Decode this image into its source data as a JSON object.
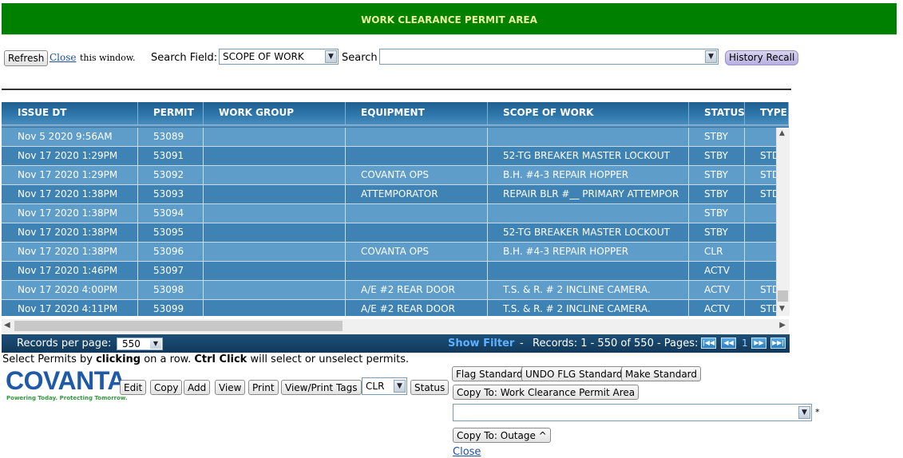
{
  "banner": {
    "title": "WORK CLEARANCE PERMIT AREA"
  },
  "topbar": {
    "refresh_label": "Refresh",
    "close_link": "Close",
    "close_suffix": "this window.",
    "search_field_label": "Search Field:",
    "search_field_value": "SCOPE OF WORK",
    "search_label": "Search",
    "search_value": "",
    "history_recall_label": "History Recall"
  },
  "grid": {
    "columns": [
      "ISSUE DT",
      "PERMIT",
      "WORK GROUP",
      "EQUIPMENT REQUESTED",
      "SCOPE OF WORK",
      "STATUS",
      "TYPE"
    ],
    "rows": [
      [
        "Nov 5 2020 9:56AM",
        "53089",
        "",
        "",
        "",
        "STBY",
        ""
      ],
      [
        "Nov 17 2020 1:29PM",
        "53091",
        "",
        "",
        "52-TG BREAKER MASTER LOCKOUT",
        "STBY",
        "STD"
      ],
      [
        "Nov 17 2020 1:29PM",
        "53092",
        "",
        "COVANTA OPS",
        "B.H. #4-3 REPAIR HOPPER",
        "STBY",
        "STD"
      ],
      [
        "Nov 17 2020 1:38PM",
        "53093",
        "",
        "ATTEMPORATOR",
        "REPAIR BLR #__ PRIMARY ATTEMPOR",
        "STBY",
        "STD"
      ],
      [
        "Nov 17 2020 1:38PM",
        "53094",
        "",
        "",
        "",
        "STBY",
        ""
      ],
      [
        "Nov 17 2020 1:38PM",
        "53095",
        "",
        "",
        "52-TG BREAKER MASTER LOCKOUT",
        "STBY",
        ""
      ],
      [
        "Nov 17 2020 1:38PM",
        "53096",
        "",
        "COVANTA OPS",
        "B.H. #4-3 REPAIR HOPPER",
        "CLR",
        ""
      ],
      [
        "Nov 17 2020 1:46PM",
        "53097",
        "",
        "",
        "",
        "ACTV",
        ""
      ],
      [
        "Nov 17 2020 4:00PM",
        "53098",
        "",
        "A/E #2 REAR DOOR",
        "T.S. & R. # 2 INCLINE CAMERA.",
        "ACTV",
        "STD"
      ],
      [
        "Nov 17 2020 4:11PM",
        "53099",
        "",
        "A/E #2 REAR DOOR",
        "T.S. & R. # 2 INCLINE CAMERA.",
        "ACTV",
        "STD"
      ]
    ]
  },
  "pager": {
    "records_per_page_label": "Records per page:",
    "records_per_page_value": "550",
    "show_filter": "Show Filter",
    "dash": "-",
    "records_text": "Records: 1 - 550 of 550 - Pages:",
    "current_page": "1"
  },
  "instructions": {
    "part1": "Select Permits by ",
    "bold1": "clicking",
    "part2": " on a row. ",
    "bold2": "Ctrl Click",
    "part3": " will select or unselect permits."
  },
  "logo": {
    "name": "COVANTA",
    "tagline": "Powering Today. Protecting Tomorrow."
  },
  "actions": {
    "edit": "Edit",
    "copy": "Copy",
    "add": "Add",
    "view": "View",
    "print": "Print",
    "view_print_tags": "View/Print Tags",
    "status_select_value": "CLR",
    "status": "Status",
    "flag_standard": "Flag Standard",
    "undo_flag_standard": "UNDO FLG Standard",
    "make_standard": "Make Standard",
    "copy_to_wcp": "Copy To: Work Clearance Permit Area",
    "target_select_value": "",
    "required_mark": "*",
    "copy_to_outage": "Copy To: Outage ^",
    "close_link": "Close"
  }
}
